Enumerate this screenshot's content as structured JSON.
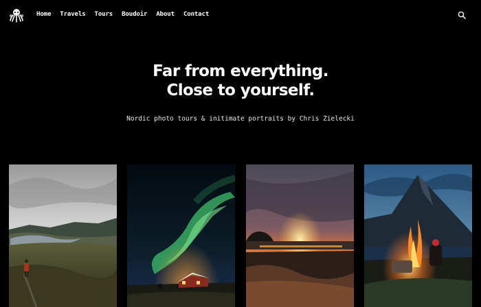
{
  "nav": {
    "logo_icon": "octopus-logo-icon",
    "items": [
      {
        "label": "Home"
      },
      {
        "label": "Travels"
      },
      {
        "label": "Tours"
      },
      {
        "label": "Boudoir"
      },
      {
        "label": "About"
      },
      {
        "label": "Contact"
      }
    ],
    "search_icon": "search-icon"
  },
  "hero": {
    "title_line1": "Far from everything.",
    "title_line2": "Close to yourself.",
    "subtitle": "Nordic photo tours & initimate portraits by Chris Zielecki"
  },
  "gallery": {
    "photos": [
      {
        "subject": "hiker-on-misty-hills"
      },
      {
        "subject": "aurora-over-red-cabin"
      },
      {
        "subject": "sunset-over-beach"
      },
      {
        "subject": "campfire-under-mountain"
      }
    ]
  },
  "colors": {
    "background": "#000000",
    "text": "#ffffff"
  }
}
